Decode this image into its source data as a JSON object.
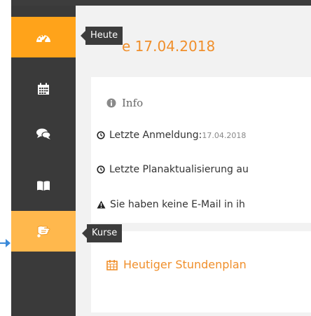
{
  "page": {
    "title": "e 17.04.2018"
  },
  "sidebar": {
    "items": [
      {
        "name": "dashboard",
        "icon": "dashboard-icon",
        "tooltip": "Heute",
        "active": true
      },
      {
        "name": "calendar",
        "icon": "calendar-icon"
      },
      {
        "name": "messages",
        "icon": "chat-icon"
      },
      {
        "name": "books",
        "icon": "book-icon"
      },
      {
        "name": "courses",
        "icon": "hand-icon",
        "tooltip": "Kurse",
        "hovered": true
      }
    ]
  },
  "info": {
    "heading": "Info",
    "last_login_label": "Letzte Anmeldung:",
    "last_login_value": "17.04.2018",
    "last_plan_update": "Letzte Planaktualisierung au",
    "email_warning": "Sie haben keine E-Mail in ih"
  },
  "schedule": {
    "heading": "Heutiger Stundenplan"
  },
  "colors": {
    "accent": "#ffa31a",
    "accent_light": "#ffb84d",
    "sidebar": "#3a3a3a",
    "title": "#f08f2b"
  }
}
